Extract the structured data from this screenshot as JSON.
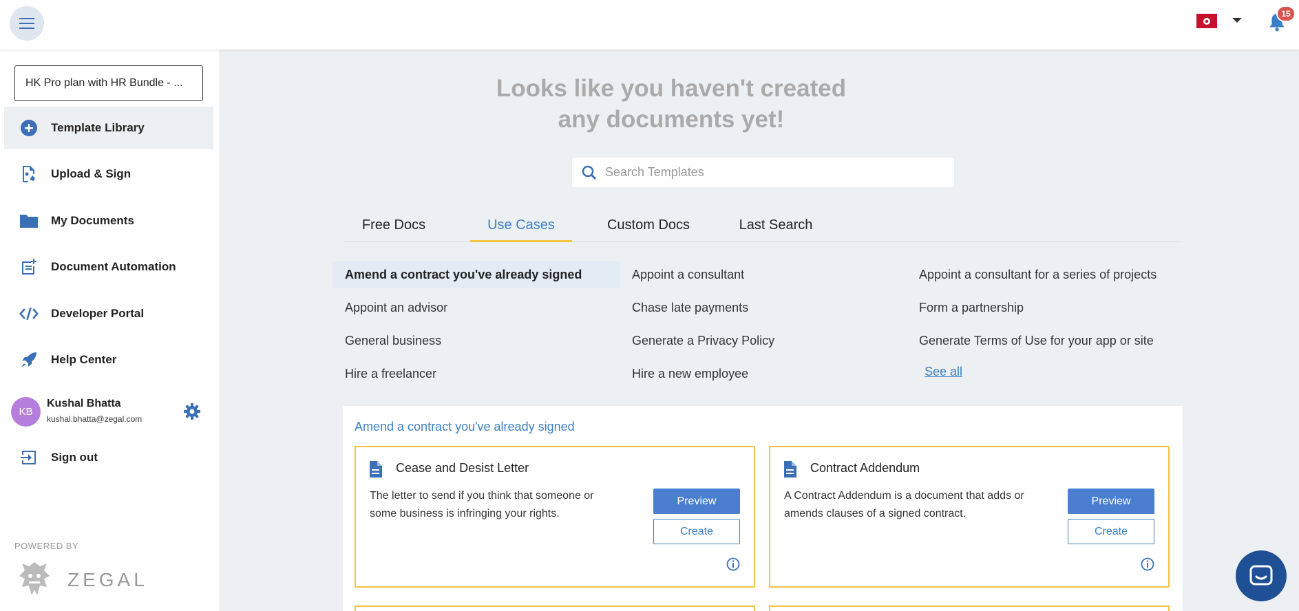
{
  "header": {
    "notification_count": "15",
    "colors": {
      "flag": "#c8102e",
      "badge": "#d9534f",
      "accent": "#3b7fc4"
    }
  },
  "sidebar": {
    "plan": "HK Pro plan with HR Bundle - ...",
    "items": [
      {
        "label": "Template Library",
        "icon": "plus-circle-icon"
      },
      {
        "label": "Upload & Sign",
        "icon": "upload-sign-icon"
      },
      {
        "label": "My Documents",
        "icon": "folder-icon"
      },
      {
        "label": "Document Automation",
        "icon": "document-automation-icon"
      },
      {
        "label": "Developer Portal",
        "icon": "code-icon"
      },
      {
        "label": "Help Center",
        "icon": "rocket-icon"
      }
    ],
    "user": {
      "initials": "KB",
      "name": "Kushal Bhatta",
      "email": "kushal.bhatta@zegal.com"
    },
    "sign_out": "Sign out",
    "powered_by": "POWERED BY",
    "brand": "ZEGAL"
  },
  "main": {
    "headline": "Looks like you haven't created any documents yet!",
    "search_placeholder": "Search Templates",
    "tabs": [
      "Free Docs",
      "Use Cases",
      "Custom Docs",
      "Last Search"
    ],
    "active_tab": "Use Cases",
    "use_cases": [
      "Amend a contract you've already signed",
      "Appoint a consultant",
      "Appoint a consultant for a series of projects",
      "Appoint an advisor",
      "Chase late payments",
      "Form a partnership",
      "General business",
      "Generate a Privacy Policy",
      "Generate Terms of Use for your app or site",
      "Hire a freelancer",
      "Hire a new employee"
    ],
    "see_all": "See all",
    "panel_title": "Amend a contract you've already signed",
    "cards": [
      {
        "title": "Cease and Desist Letter",
        "description": "The letter to send if you think that someone or some business is infringing your rights.",
        "preview": "Preview",
        "create": "Create"
      },
      {
        "title": "Contract Addendum",
        "description": "A Contract Addendum is a document that adds or amends clauses of a signed contract.",
        "preview": "Preview",
        "create": "Create"
      }
    ]
  }
}
